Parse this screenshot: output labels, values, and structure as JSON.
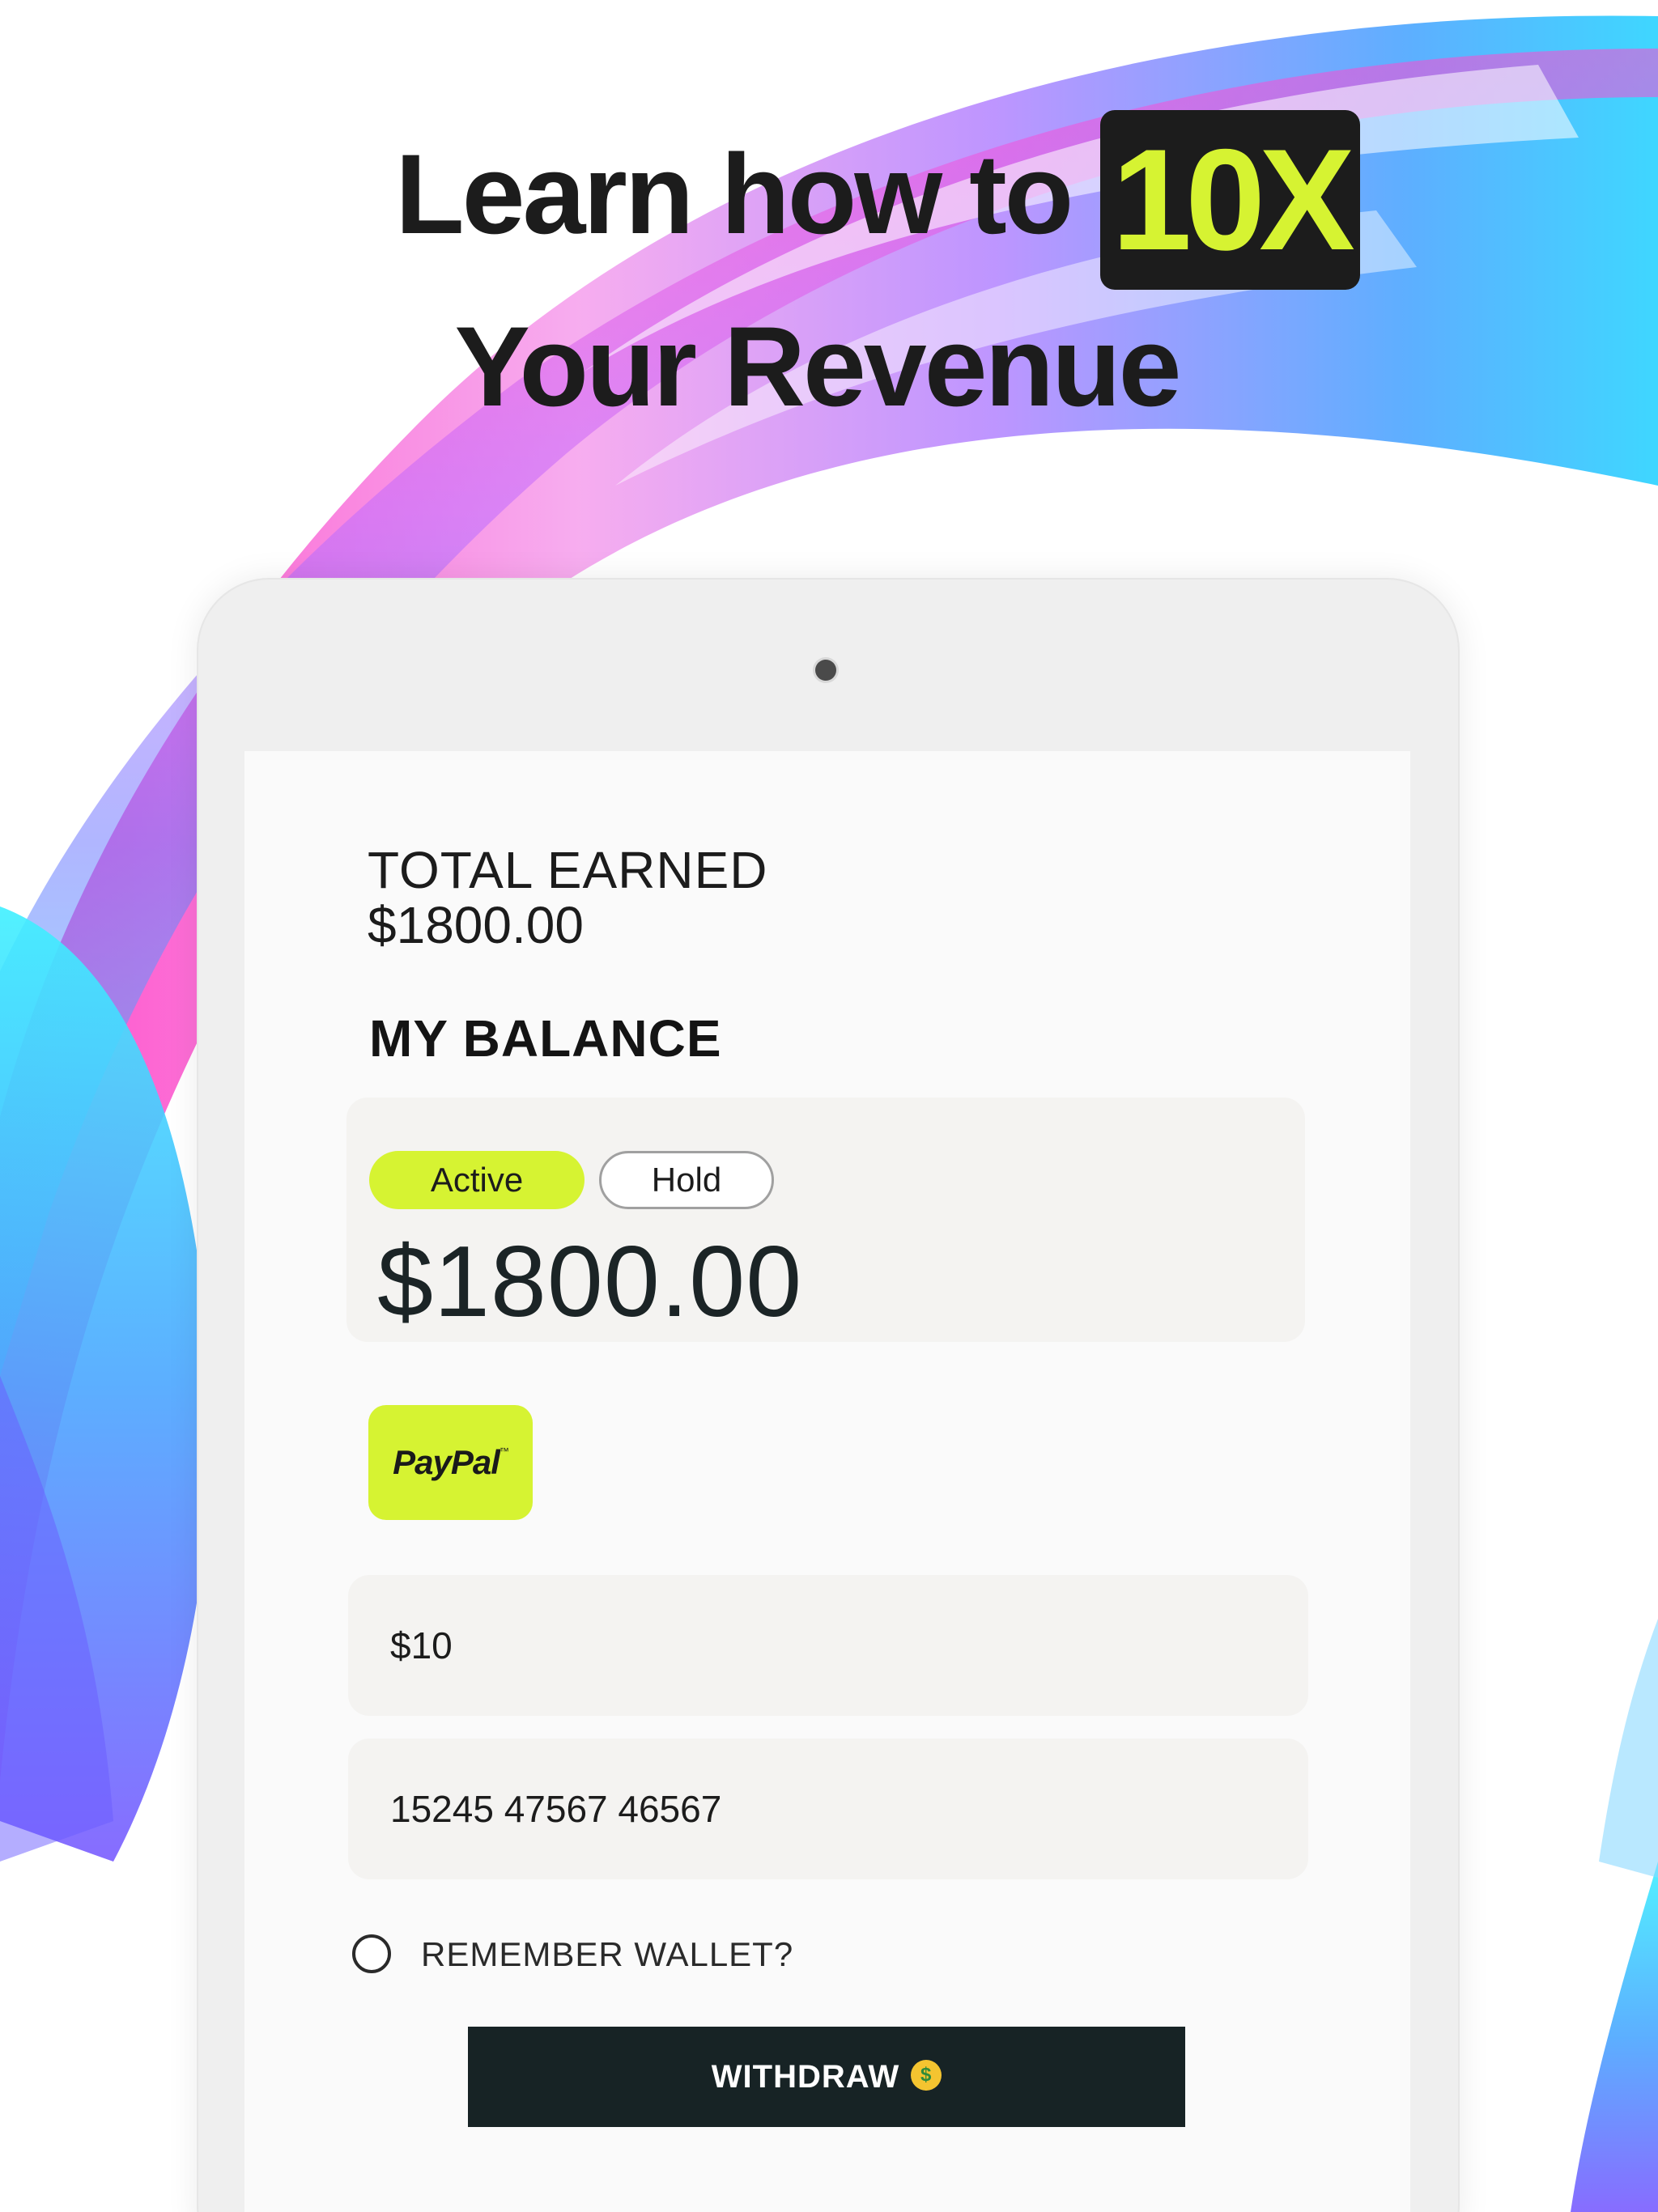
{
  "headline": {
    "line1_prefix": "Learn how to",
    "line1_highlight": "10X",
    "line2": "Your Revenue"
  },
  "colors": {
    "accent": "#d6f332",
    "dark": "#172325",
    "text": "#1c1c1c"
  },
  "summary": {
    "total_earned_label": "TOTAL EARNED",
    "total_earned_value": "$1800.00",
    "balance_title": "MY BALANCE"
  },
  "balance_card": {
    "tabs": [
      {
        "label": "Active",
        "selected": true
      },
      {
        "label": "Hold",
        "selected": false
      }
    ],
    "amount": "$1800.00"
  },
  "payment_method": {
    "name": "PayPal",
    "tm": "™",
    "icon": "paypal-logo"
  },
  "form": {
    "amount_value": "$10",
    "wallet_value": "15245 47567 46567",
    "remember_label": "REMEMBER WALLET?",
    "remember_checked": false
  },
  "withdraw": {
    "label": "WITHDRAW",
    "emoji_icon": "money-mouth-face-icon"
  }
}
